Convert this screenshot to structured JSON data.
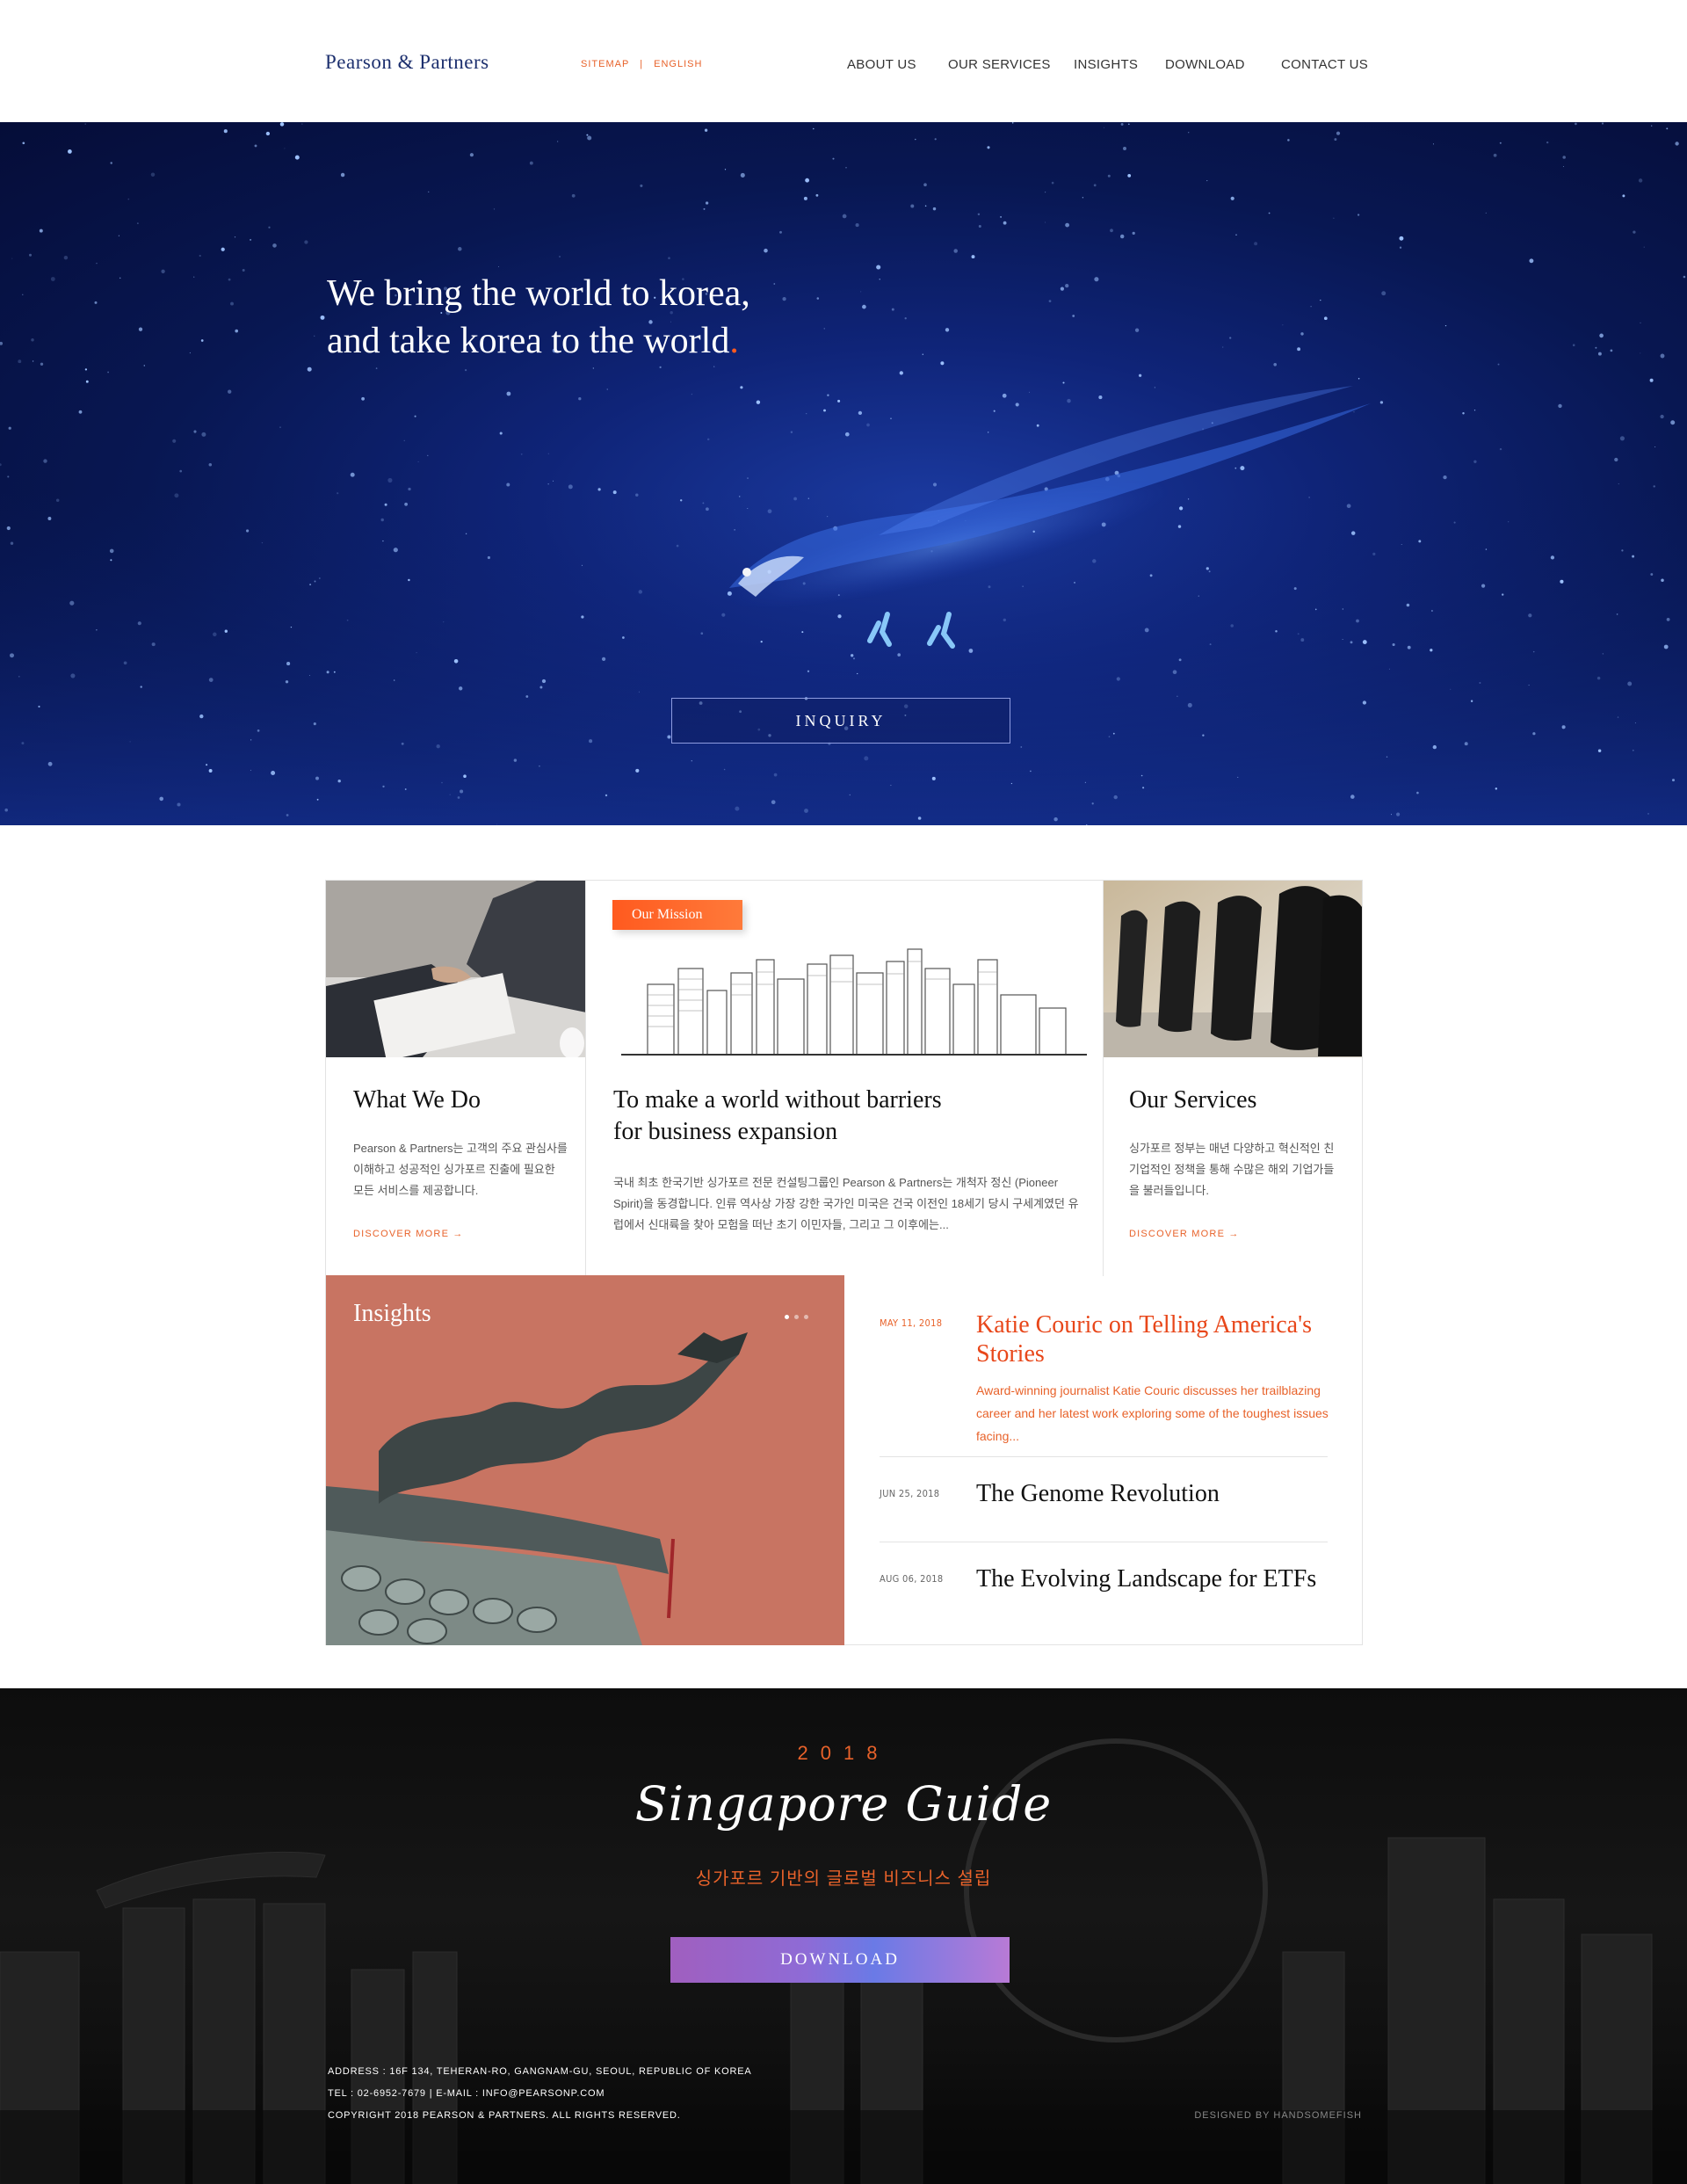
{
  "header": {
    "logo": "Pearson & Partners",
    "util_links": [
      "SITEMAP",
      "ENGLISH"
    ],
    "nav": [
      "ABOUT US",
      "OUR SERVICES",
      "INSIGHTS",
      "DOWNLOAD",
      "CONTACT US"
    ]
  },
  "hero": {
    "line1": "We bring the world to korea,",
    "line2": "and take korea to the world",
    "line2_dot": ".",
    "button": "INQUIRY"
  },
  "cards": {
    "what": {
      "title": "What We Do",
      "body": "Pearson & Partners는 고객의 주요 관심사를 이해하고 성공적인 싱가포르 진출에 필요한 모든 서비스를 제공합니다.",
      "link": "DISCOVER MORE"
    },
    "mission": {
      "tag": "Our Mission",
      "title_line1": "To make a world without barriers",
      "title_line2": "for business expansion",
      "body": "국내 최초 한국기반 싱가포르 전문 컨설팅그룹인 Pearson & Partners는 개척자 정신 (Pioneer Spirit)을 동경합니다. 인류 역사상 가장 강한 국가인 미국은 건국 이전인 18세기 당시 구세계였던 유럽에서 신대륙을 찾아 모험을 떠난 초기 이민자들, 그리고 그 이후에는..."
    },
    "services": {
      "title": "Our Services",
      "body": "싱가포르 정부는 매년 다양하고 혁신적인 친기업적인 정책을 통해 수많은 해외 기업가들을 불러들입니다.",
      "link": "DISCOVER MORE"
    }
  },
  "insights": {
    "title": "Insights",
    "items": [
      {
        "date": "MAY 11, 2018",
        "title": "Katie Couric on Telling America's Stories",
        "desc": "Award-winning journalist Katie Couric discusses her trailblazing career and her latest work exploring some of the toughest issues facing..."
      },
      {
        "date": "JUN 25, 2018",
        "title": "The Genome Revolution"
      },
      {
        "date": "AUG 06, 2018",
        "title": "The Evolving Landscape for ETFs"
      }
    ]
  },
  "footer": {
    "year": "2018",
    "guide": "Singapore Guide",
    "sub": "싱가포르 기반의 글로벌 비즈니스 설립",
    "button": "DOWNLOAD",
    "address": "ADDRESS : 16F 134, TEHERAN-RO, GANGNAM-GU, SEOUL, REPUBLIC OF KOREA",
    "contact": "TEL : 02-6952-7679   |   E-MAIL : INFO@PEARSONP.COM",
    "copyright": "COPYRIGHT 2018 PEARSON & PARTNERS. ALL RIGHTS RESERVED.",
    "designed": "DESIGNED BY HANDSOMEFISH"
  },
  "colors": {
    "accent": "#e8622a",
    "navy": "#1c2f6e",
    "hero_blue": "#0f2478"
  }
}
